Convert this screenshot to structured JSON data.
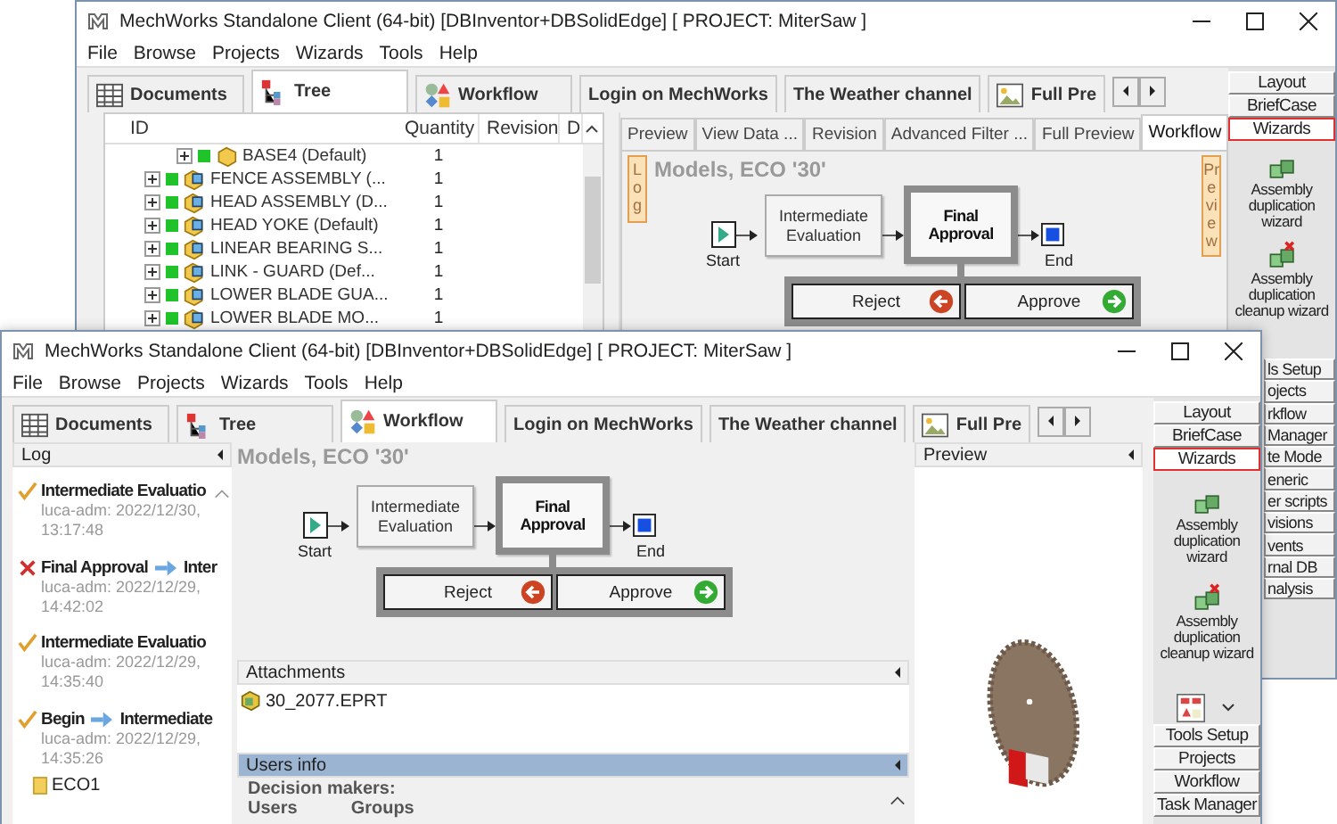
{
  "back_window": {
    "title": "MechWorks Standalone Client (64-bit) [DBInventor+DBSolidEdge] [ PROJECT: MiterSaw ]",
    "menu": [
      "File",
      "Browse",
      "Projects",
      "Wizards",
      "Tools",
      "Help"
    ],
    "tabs": [
      {
        "label": "Documents",
        "selected": false
      },
      {
        "label": "Tree",
        "selected": true
      },
      {
        "label": "Workflow",
        "selected": false
      },
      {
        "label": "Login on MechWorks",
        "selected": false
      },
      {
        "label": "The Weather channel",
        "selected": false
      },
      {
        "label": "Full Pre",
        "selected": false
      }
    ],
    "tree": {
      "columns": [
        "ID",
        "Quantity",
        "Revision",
        "D"
      ],
      "rows": [
        {
          "children": [
            {
              "id": "BASE4 (Default)",
              "quantity": "1",
              "kind": "part",
              "expanded": false
            }
          ]
        },
        {
          "id": "FENCE ASSEMBLY (...",
          "quantity": "1",
          "kind": "assembly",
          "expanded": false
        },
        {
          "id": "HEAD ASSEMBLY (D...",
          "quantity": "1",
          "kind": "assembly",
          "expanded": false
        },
        {
          "id": "HEAD YOKE (Default)",
          "quantity": "1",
          "kind": "assembly",
          "expanded": false
        },
        {
          "id": "LINEAR BEARING S...",
          "quantity": "1",
          "kind": "assembly",
          "expanded": false
        },
        {
          "id": "LINK - GUARD (Def...",
          "quantity": "1",
          "kind": "assembly",
          "expanded": false
        },
        {
          "id": "LOWER BLADE GUA...",
          "quantity": "1",
          "kind": "assembly",
          "expanded": false
        },
        {
          "id": "LOWER BLADE MO...",
          "quantity": "1",
          "kind": "assembly",
          "expanded": false
        }
      ]
    },
    "sub_tabs": [
      {
        "label": "Preview",
        "selected": false
      },
      {
        "label": "View Data ...",
        "selected": false
      },
      {
        "label": "Revision",
        "selected": false
      },
      {
        "label": "Advanced Filter ...",
        "selected": false
      },
      {
        "label": "Full Preview",
        "selected": false
      },
      {
        "label": "Workflow",
        "selected": true
      }
    ],
    "side_tabs": [
      "Log",
      "Preview"
    ],
    "workflow": {
      "title": "Models, ECO '30'",
      "start": "Start",
      "end": "End",
      "steps": [
        {
          "label": "Intermediate Evaluation",
          "current": false
        },
        {
          "label": "Final Approval",
          "current": true
        }
      ],
      "actions": [
        "Reject",
        "Approve"
      ]
    },
    "side_buttons": [
      {
        "label": "Layout",
        "selected": false
      },
      {
        "label": "BriefCase",
        "selected": false
      },
      {
        "label": "Wizards",
        "selected": true
      }
    ],
    "wizards": [
      "Assembly duplication wizard",
      "Assembly duplication cleanup wizard"
    ],
    "more_buttons": [
      "ls Setup",
      "ojects",
      "rkflow",
      "Manager",
      "te Mode",
      "eneric",
      "er scripts",
      "visions",
      "vents",
      "rnal DB",
      "nalysis"
    ]
  },
  "front_window": {
    "title": "MechWorks Standalone Client (64-bit) [DBInventor+DBSolidEdge] [ PROJECT: MiterSaw ]",
    "menu": [
      "File",
      "Browse",
      "Projects",
      "Wizards",
      "Tools",
      "Help"
    ],
    "tabs": [
      {
        "label": "Documents",
        "selected": false
      },
      {
        "label": "Tree",
        "selected": false
      },
      {
        "label": "Workflow",
        "selected": true
      },
      {
        "label": "Login on MechWorks",
        "selected": false
      },
      {
        "label": "The Weather channel",
        "selected": false
      },
      {
        "label": "Full Pre",
        "selected": false
      }
    ],
    "log": {
      "title": "Log",
      "entries": [
        {
          "kind": "approved",
          "from": "Intermediate Evaluatio",
          "user": "luca-adm: 2022/12/30,",
          "time": "13:17:48"
        },
        {
          "kind": "rejected",
          "from": "Final Approval",
          "to": "Inter",
          "user": "luca-adm: 2022/12/29,",
          "time": "14:42:02"
        },
        {
          "kind": "approved",
          "from": "Intermediate Evaluatio",
          "user": "luca-adm: 2022/12/29,",
          "time": "14:35:40"
        },
        {
          "kind": "approved",
          "from": "Begin",
          "to": "Intermediate",
          "user": "luca-adm: 2022/12/29,",
          "time": "14:35:26"
        }
      ],
      "document": "ECO1"
    },
    "workflow": {
      "title": "Models, ECO '30'",
      "start": "Start",
      "end": "End",
      "steps": [
        {
          "label": "Intermediate Evaluation",
          "current": false
        },
        {
          "label": "Final Approval",
          "current": true
        }
      ],
      "actions": [
        "Reject",
        "Approve"
      ]
    },
    "attachments": {
      "title": "Attachments",
      "items": [
        "30_2077.EPRT"
      ]
    },
    "users_info": {
      "title": "Users info",
      "heading": "Decision makers:",
      "columns": [
        "Users",
        "Groups"
      ]
    },
    "preview": {
      "title": "Preview"
    },
    "side_buttons": [
      {
        "label": "Layout",
        "selected": false
      },
      {
        "label": "BriefCase",
        "selected": false
      },
      {
        "label": "Wizards",
        "selected": true
      }
    ],
    "wizards": [
      "Assembly duplication wizard",
      "Assembly duplication cleanup wizard"
    ],
    "more_buttons": [
      "Tools Setup",
      "Projects",
      "Workflow",
      "Task Manager"
    ]
  }
}
